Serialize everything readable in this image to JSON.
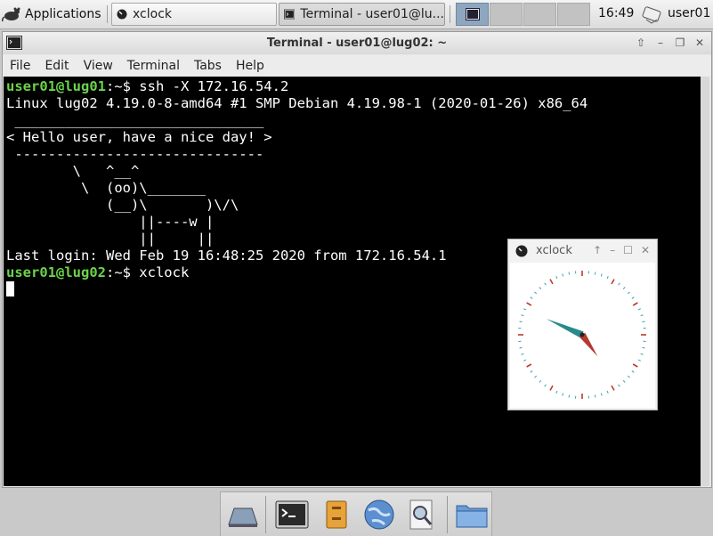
{
  "panel": {
    "applications_label": "Applications",
    "tasks": [
      {
        "label": "xclock"
      },
      {
        "label": "Terminal - user01@lu..."
      }
    ],
    "time": "16:49",
    "user": "user01"
  },
  "terminal": {
    "title": "Terminal - user01@lug02: ~",
    "menu": [
      "File",
      "Edit",
      "View",
      "Terminal",
      "Tabs",
      "Help"
    ],
    "prompt1_user": "user01@lug01",
    "prompt1_rest": ":~$ ssh -X 172.16.54.2",
    "line_uname": "Linux lug02 4.19.0-8-amd64 #1 SMP Debian 4.19.98-1 (2020-01-26) x86_64",
    "line_blank": "",
    "cow_top": " ______________________________",
    "cow_msg": "< Hello user, have a nice day! >",
    "cow_bottom": " ------------------------------",
    "cow1": "        \\   ^__^",
    "cow2": "         \\  (oo)\\_______",
    "cow3": "            (__)\\       )\\/\\",
    "cow4": "                ||----w |",
    "cow5": "                ||     ||",
    "last_login": "Last login: Wed Feb 19 16:48:25 2020 from 172.16.54.1",
    "prompt2_user": "user01@lug02",
    "prompt2_rest": ":~$ xclock"
  },
  "xclock": {
    "title": "xclock",
    "time_shown": "16:49"
  },
  "colors": {
    "prompt_user": "#6bd34a",
    "prompt_path": "#6b84d6",
    "clock_hour_hand": "#2a8a8a",
    "clock_minute_hand": "#b53a32"
  }
}
